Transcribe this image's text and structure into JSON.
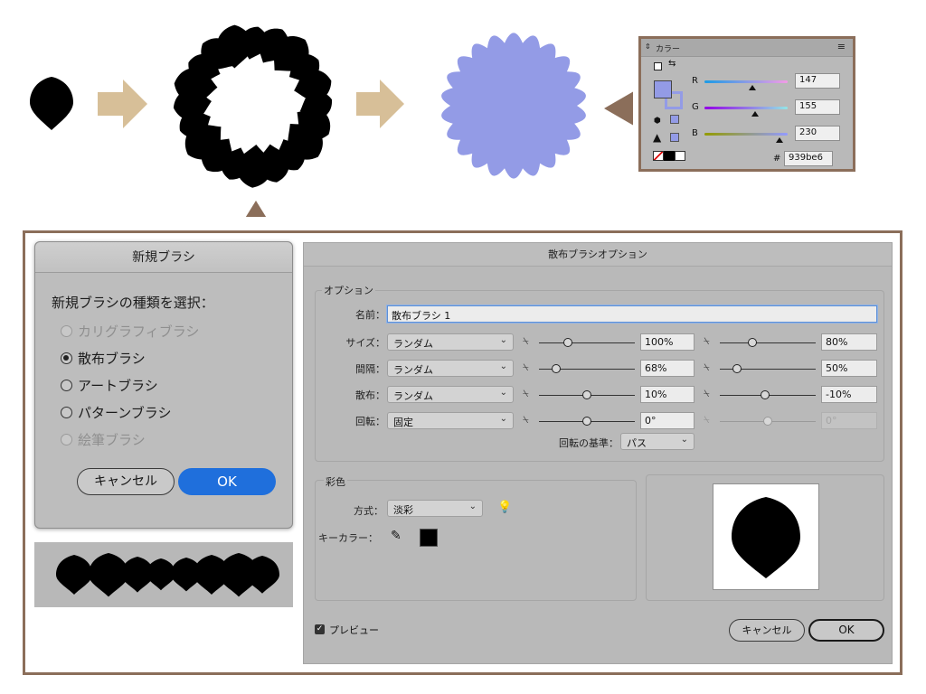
{
  "colors": {
    "swatch_fill": "#939be6",
    "frame_border": "#8b6e5a",
    "arrow_tan": "#d7bf98",
    "ok_blue": "#1f6fdc"
  },
  "color_panel": {
    "toggle_icon": "double-triangle-icon",
    "title": "カラー",
    "menu_icon": "hamburger-menu-icon",
    "r_label": "R",
    "g_label": "G",
    "b_label": "B",
    "r_value": "147",
    "g_value": "155",
    "b_value": "230",
    "hex_prefix": "#",
    "hex_value": "939be6",
    "r_level": 0.576,
    "g_level": 0.608,
    "b_level": 0.902
  },
  "new_brush": {
    "title": "新規ブラシ",
    "prompt": "新規ブラシの種類を選択：",
    "options": [
      {
        "label": "カリグラフィブラシ",
        "selected": false,
        "disabled": true
      },
      {
        "label": "散布ブラシ",
        "selected": true,
        "disabled": false
      },
      {
        "label": "アートブラシ",
        "selected": false,
        "disabled": false
      },
      {
        "label": "パターンブラシ",
        "selected": false,
        "disabled": false
      },
      {
        "label": "絵筆ブラシ",
        "selected": false,
        "disabled": true
      }
    ],
    "cancel_label": "キャンセル",
    "ok_label": "OK"
  },
  "scatter": {
    "title": "散布ブラシオプション",
    "options_group": "オプション",
    "name_label": "名前：",
    "name_value": "散布ブラシ 1",
    "rows": [
      {
        "label": "サイズ：",
        "mode": "ランダム",
        "min": "100%",
        "max": "80%",
        "min_level": 0.3,
        "max_level": 0.34,
        "disabled": false
      },
      {
        "label": "間隔：",
        "mode": "ランダム",
        "min": "68%",
        "max": "50%",
        "min_level": 0.18,
        "max_level": 0.18,
        "disabled": false
      },
      {
        "label": "散布：",
        "mode": "ランダム",
        "min": "10%",
        "max": "-10%",
        "min_level": 0.5,
        "max_level": 0.47,
        "disabled": false
      },
      {
        "label": "回転：",
        "mode": "固定",
        "min": "0°",
        "max": "0°",
        "min_level": 0.5,
        "max_level": 0.5,
        "disabled": true
      }
    ],
    "rotation_basis_label": "回転の基準：",
    "rotation_basis_value": "パス",
    "colorize_group": "彩色",
    "method_label": "方式：",
    "method_value": "淡彩",
    "key_color_label": "キーカラー：",
    "key_color": "#000000",
    "preview_label": "プレビュー",
    "preview_checked": true,
    "cancel_label": "キャンセル",
    "ok_label": "OK"
  }
}
